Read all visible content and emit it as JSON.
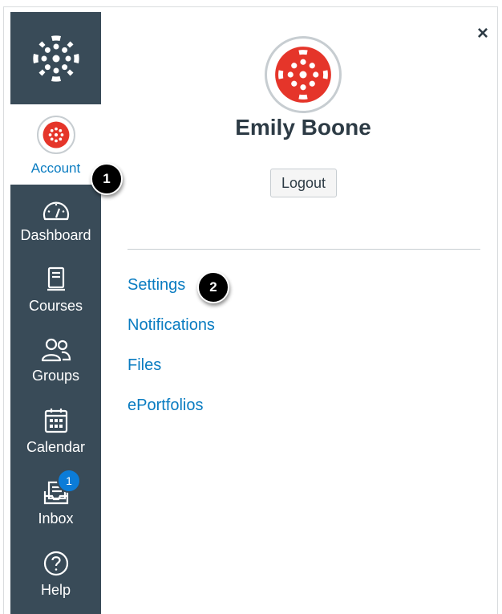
{
  "nav": {
    "account_label": "Account",
    "items": [
      {
        "label": "Dashboard",
        "icon": "dashboard-icon"
      },
      {
        "label": "Courses",
        "icon": "courses-icon"
      },
      {
        "label": "Groups",
        "icon": "groups-icon"
      },
      {
        "label": "Calendar",
        "icon": "calendar-icon"
      },
      {
        "label": "Inbox",
        "icon": "inbox-icon",
        "badge": "1"
      },
      {
        "label": "Help",
        "icon": "help-icon"
      }
    ]
  },
  "tray": {
    "close_label": "×",
    "user_name": "Emily Boone",
    "logout_label": "Logout",
    "links": [
      "Settings",
      "Notifications",
      "Files",
      "ePortfolios"
    ]
  },
  "callouts": [
    "1",
    "2"
  ],
  "colors": {
    "nav_bg": "#394b58",
    "link": "#0a7cc1",
    "brand_red": "#e5352a",
    "badge": "#0b7cd8"
  }
}
